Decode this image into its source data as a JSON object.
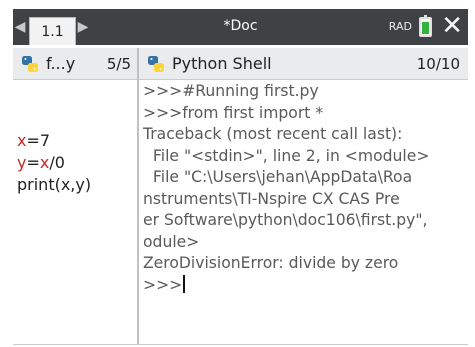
{
  "topbar": {
    "tab_label": "1.1",
    "doc_title": "*Doc",
    "angle_mode": "RAD",
    "close_glyph": "✕",
    "battery_fill": 0.75
  },
  "left_pane": {
    "title": "f...y",
    "pages": "5/5"
  },
  "right_pane": {
    "title": "Python Shell",
    "pages": "10/10"
  },
  "editor": {
    "lines": [
      [
        {
          "t": "x",
          "c": "var"
        },
        {
          "t": "=7",
          "c": "plain"
        }
      ],
      [
        {
          "t": "y",
          "c": "var"
        },
        {
          "t": "=",
          "c": "plain"
        },
        {
          "t": "x",
          "c": "var"
        },
        {
          "t": "/0",
          "c": "plain"
        }
      ],
      [
        {
          "t": "print(x,y)",
          "c": "plain"
        }
      ]
    ]
  },
  "shell": {
    "lines": [
      ">>>#Running first.py",
      ">>>from first import *",
      "Traceback (most recent call last):",
      "  File \"<stdin>\", line 2, in <module>",
      "  File \"C:\\Users\\jehan\\AppData\\Roa",
      "nstruments\\TI-Nspire CX CAS Pre",
      "er Software\\python\\doc106\\first.py\",",
      "odule>",
      "ZeroDivisionError: divide by zero",
      ">>>"
    ]
  },
  "colors": {
    "topbar_bg": "#3e4245",
    "header_bg": "#e9ebed",
    "var_red": "#c32b2b",
    "battery_green": "#34b23a",
    "python_blue": "#3572a5",
    "python_yellow": "#ffd43b"
  },
  "icons": [
    "chevron-left-icon",
    "chevron-right-icon",
    "battery-icon",
    "close-icon",
    "python-icon"
  ]
}
